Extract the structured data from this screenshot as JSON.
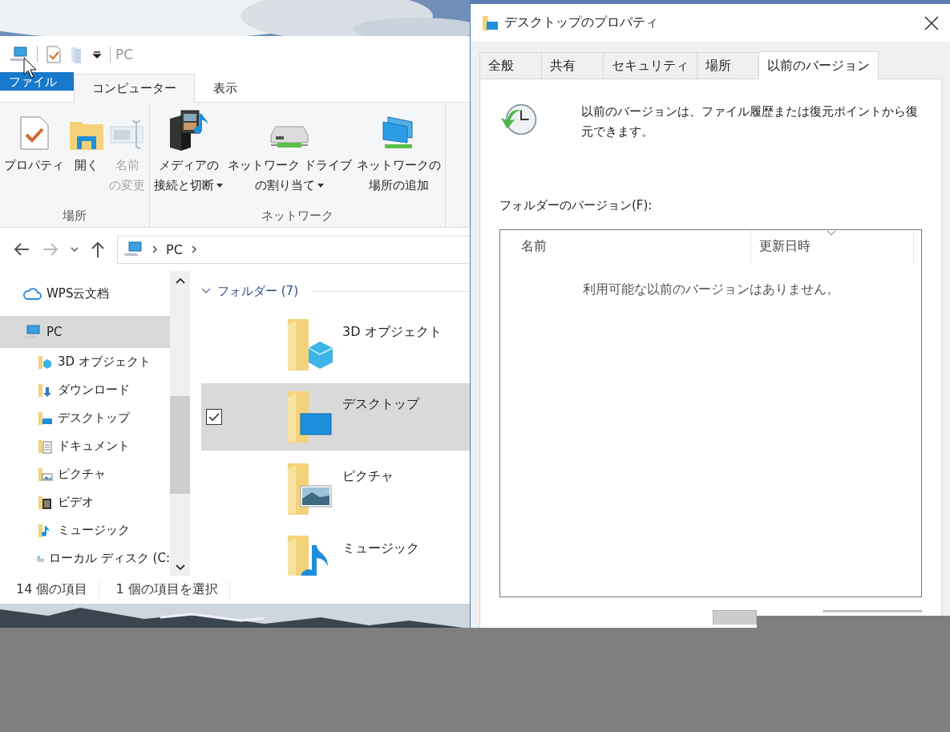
{
  "explorer": {
    "quick_access": {
      "location": "PC"
    },
    "ribbon_tabs": [
      {
        "label": "ファイル",
        "kind": "file",
        "selected": false
      },
      {
        "label": "コンピューター",
        "kind": "tab",
        "selected": true
      },
      {
        "label": "表示",
        "kind": "tab",
        "selected": false
      }
    ],
    "ribbon_groups": [
      {
        "label": "場所",
        "commands": [
          {
            "lines": [
              "プロパティ"
            ],
            "kind": "properties",
            "disabled": false,
            "dropdown": false
          },
          {
            "lines": [
              "開く"
            ],
            "kind": "open",
            "disabled": false,
            "dropdown": false
          },
          {
            "lines": [
              "名前",
              "の変更"
            ],
            "kind": "rename",
            "disabled": true,
            "dropdown": false
          }
        ]
      },
      {
        "label": "ネットワーク",
        "commands": [
          {
            "lines": [
              "メディアの",
              "接続と切断"
            ],
            "kind": "media",
            "disabled": false,
            "dropdown": true
          },
          {
            "lines": [
              "ネットワーク ドライブ",
              "の割り当て"
            ],
            "kind": "drive",
            "disabled": false,
            "dropdown": true
          },
          {
            "lines": [
              "ネットワークの",
              "場所の追加"
            ],
            "kind": "netloc",
            "disabled": false,
            "dropdown": false
          }
        ]
      }
    ],
    "address": {
      "segments": [
        "PC"
      ]
    },
    "nav_items": [
      {
        "label": "WPS云文档",
        "kind": "cloud",
        "selected": false
      },
      {
        "label": "PC",
        "kind": "pc",
        "selected": true,
        "children": [
          {
            "label": "3D オブジェクト",
            "kind": "cube",
            "selected": false
          },
          {
            "label": "ダウンロード",
            "kind": "download",
            "selected": false
          },
          {
            "label": "デスクトップ",
            "kind": "desktop",
            "selected": false
          },
          {
            "label": "ドキュメント",
            "kind": "document",
            "selected": false
          },
          {
            "label": "ピクチャ",
            "kind": "picture",
            "selected": false
          },
          {
            "label": "ビデオ",
            "kind": "video",
            "selected": false
          },
          {
            "label": "ミュージック",
            "kind": "music",
            "selected": false
          },
          {
            "label": "ローカル ディスク (C:",
            "kind": "disk",
            "selected": false
          }
        ]
      }
    ],
    "group_header": {
      "label": "フォルダー (7)",
      "expanded": true
    },
    "folders": [
      {
        "label": "3D オブジェクト",
        "kind": "cube",
        "selected": false
      },
      {
        "label": "デスクトップ",
        "kind": "desktop",
        "selected": true
      },
      {
        "label": "ピクチャ",
        "kind": "picture",
        "selected": false
      },
      {
        "label": "ミュージック",
        "kind": "music",
        "selected": false
      }
    ],
    "status_bar": [
      "14 個の項目",
      "1 個の項目を選択"
    ]
  },
  "dialog": {
    "title": "デスクトップのプロパティ",
    "tabs": [
      {
        "label": "全般",
        "selected": false
      },
      {
        "label": "共有",
        "selected": false
      },
      {
        "label": "セキュリティ",
        "selected": false
      },
      {
        "label": "場所",
        "selected": false
      },
      {
        "label": "以前のバージョン",
        "selected": true
      }
    ],
    "message": "以前のバージョンは、ファイル履歴または復元ポイントから復元できます。",
    "list_label": "フォルダーのバージョン(F):",
    "columns": [
      {
        "label": "名前",
        "sorted": false
      },
      {
        "label": "更新日時",
        "sorted": true
      }
    ],
    "empty_text": "利用可能な以前のバージョンはありません。"
  }
}
